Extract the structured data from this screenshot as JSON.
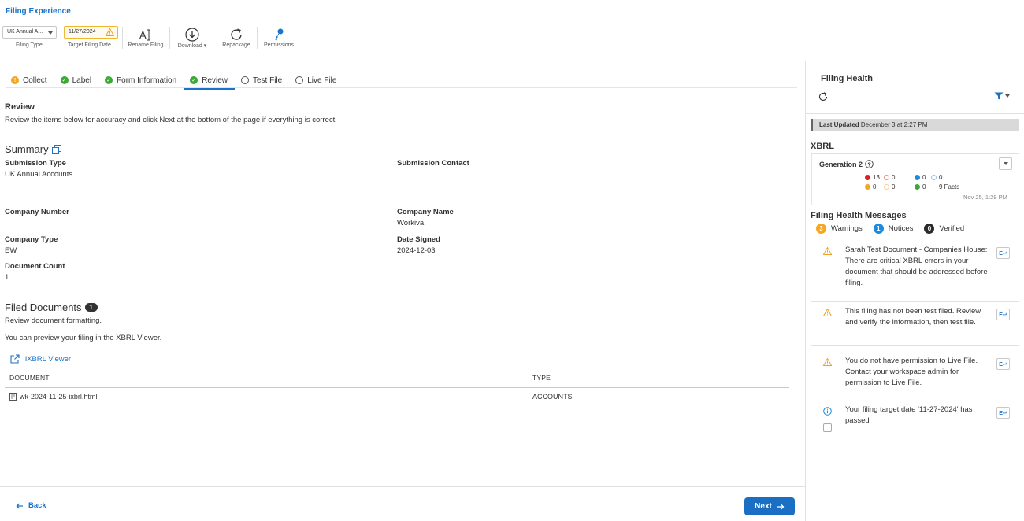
{
  "app": {
    "title": "Filing Experience"
  },
  "toolbar": {
    "filing_type_value": "UK Annual A...",
    "filing_type_caption": "Filing Type",
    "target_date_value": "11/27/2024",
    "target_date_caption": "Target Filing Date",
    "rename_label": "Rename Filing",
    "download_label": "Download",
    "repackage_label": "Repackage",
    "permissions_label": "Permissions"
  },
  "steps": [
    {
      "label": "Collect",
      "status": "warning",
      "badge": "!"
    },
    {
      "label": "Label",
      "status": "done"
    },
    {
      "label": "Form Information",
      "status": "done"
    },
    {
      "label": "Review",
      "status": "done"
    },
    {
      "label": "Test File",
      "status": "empty"
    },
    {
      "label": "Live File",
      "status": "empty"
    }
  ],
  "review": {
    "title": "Review",
    "description": "Review the items below for accuracy and click Next at the bottom of the page if everything is correct."
  },
  "summary": {
    "title": "Summary",
    "submission_type_label": "Submission Type",
    "submission_type_value": "UK Annual Accounts",
    "submission_contact_label": "Submission Contact",
    "company_number_label": "Company Number",
    "company_name_label": "Company Name",
    "company_name_value": "Workiva",
    "company_type_label": "Company Type",
    "company_type_value": "EW",
    "date_signed_label": "Date Signed",
    "date_signed_value": "2024-12-03",
    "document_count_label": "Document Count",
    "document_count_value": "1"
  },
  "filed_documents": {
    "title": "Filed Documents",
    "count": "1",
    "desc1": "Review document formatting.",
    "desc2": "You can preview your filing in the XBRL Viewer.",
    "viewer_link": "iXBRL Viewer",
    "columns": [
      "DOCUMENT",
      "TYPE"
    ],
    "rows": [
      {
        "document": "wk-2024-11-25-ixbrl.html",
        "type": "ACCOUNTS"
      }
    ]
  },
  "footer": {
    "back_label": "Back",
    "next_label": "Next"
  },
  "health": {
    "title": "Filing Health",
    "last_updated_label": "Last Updated",
    "last_updated_value": "December 3 at 2:27 PM",
    "xbrl_title": "XBRL",
    "generation_label": "Generation 2",
    "counts": {
      "red": "13",
      "red_outline": "0",
      "blue": "0",
      "blue_outline": "0",
      "orange": "0",
      "orange_outline": "0",
      "green": "0",
      "facts": "9 Facts"
    },
    "generated_time": "Nov 25, 1:29 PM",
    "messages_title": "Filing Health Messages",
    "warnings_count": "3",
    "warnings_label": "Warnings",
    "notices_count": "1",
    "notices_label": "Notices",
    "verified_count": "0",
    "verified_label": "Verified",
    "messages": [
      {
        "type": "warning",
        "text": "Sarah Test Document - Companies House: There are critical XBRL errors in your document that should be addressed before filing."
      },
      {
        "type": "warning",
        "text": "This filing has not been test filed. Review and verify the information, then test file."
      },
      {
        "type": "warning",
        "text": "You do not have permission to Live File. Contact your workspace admin for permission to Live File."
      },
      {
        "type": "notice",
        "text": "Your filing target date '11-27-2024' has passed"
      }
    ],
    "colors": {
      "red": "#e02020",
      "orange": "#f5a623",
      "blue": "#1a8ce0",
      "green": "#3aaa35"
    }
  }
}
